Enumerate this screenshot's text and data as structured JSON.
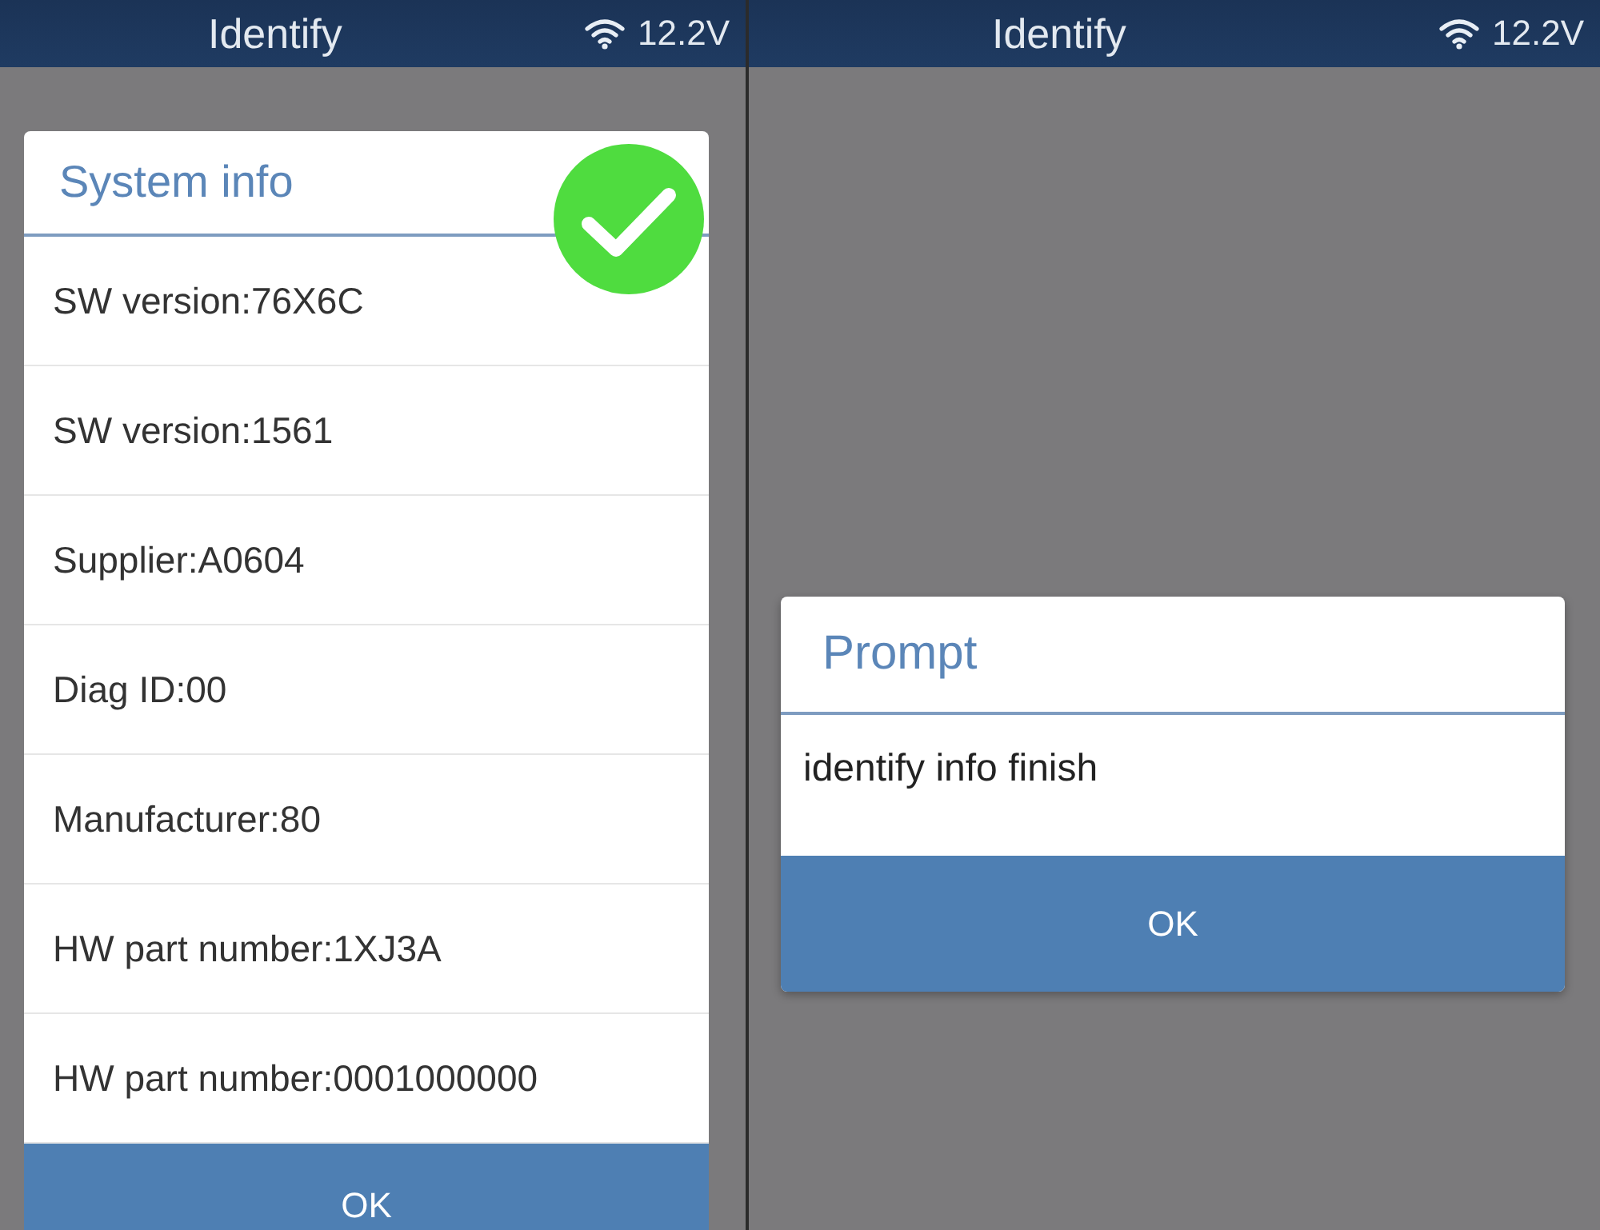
{
  "screens": [
    {
      "status_bar": {
        "title": "Identify",
        "voltage": "12.2V"
      },
      "dialog": {
        "kind": "list",
        "title": "System info",
        "success_badge": true,
        "rows": [
          "SW version:76X6C",
          "SW version:1561",
          "Supplier:A0604",
          "Diag ID:00",
          "Manufacturer:80",
          "HW part number:1XJ3A",
          "HW part number:0001000000"
        ],
        "button": "OK"
      }
    },
    {
      "status_bar": {
        "title": "Identify",
        "voltage": "12.2V"
      },
      "dialog": {
        "kind": "message",
        "title": "Prompt",
        "message": "identify info finish",
        "button": "OK"
      }
    }
  ]
}
